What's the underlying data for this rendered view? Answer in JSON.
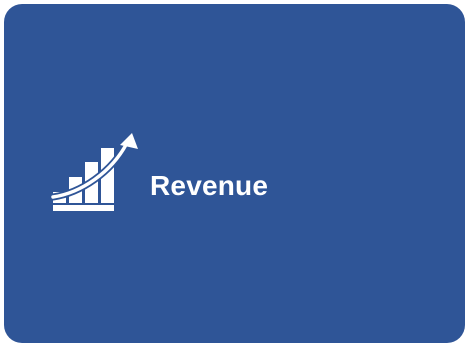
{
  "card": {
    "title": "Revenue",
    "icon": "growth-chart-icon",
    "background_color": "#2F5597",
    "text_color": "#FFFFFF"
  }
}
